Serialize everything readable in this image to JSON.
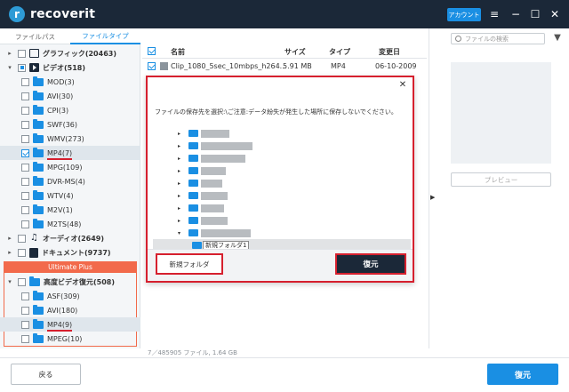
{
  "app": {
    "logo_text": "recoverit",
    "account_label": "アカウント"
  },
  "left_tabs": [
    "ファイルパス",
    "ファイルタイプ"
  ],
  "tree": [
    {
      "label": "グラフィック(20463)",
      "level": 0,
      "arrow": "▸",
      "check": "none",
      "icon": "graphics",
      "bold": true
    },
    {
      "label": "ビデオ(518)",
      "level": 0,
      "arrow": "▾",
      "check": "partial",
      "icon": "video",
      "bold": true
    },
    {
      "label": "MOD(3)",
      "level": 1,
      "check": "none",
      "icon": "folder"
    },
    {
      "label": "AVI(30)",
      "level": 1,
      "check": "none",
      "icon": "folder"
    },
    {
      "label": "CPI(3)",
      "level": 1,
      "check": "none",
      "icon": "folder"
    },
    {
      "label": "SWF(36)",
      "level": 1,
      "check": "none",
      "icon": "folder"
    },
    {
      "label": "WMV(273)",
      "level": 1,
      "check": "none",
      "icon": "folder"
    },
    {
      "label": "MP4(7)",
      "level": 1,
      "check": "checked",
      "icon": "folder",
      "selected": true,
      "underline": true
    },
    {
      "label": "MPG(109)",
      "level": 1,
      "check": "none",
      "icon": "folder"
    },
    {
      "label": "DVR-MS(4)",
      "level": 1,
      "check": "none",
      "icon": "folder"
    },
    {
      "label": "WTV(4)",
      "level": 1,
      "check": "none",
      "icon": "folder"
    },
    {
      "label": "M2V(1)",
      "level": 1,
      "check": "none",
      "icon": "folder"
    },
    {
      "label": "M2TS(48)",
      "level": 1,
      "check": "none",
      "icon": "folder"
    },
    {
      "label": "オーディオ(2649)",
      "level": 0,
      "arrow": "▸",
      "check": "none",
      "icon": "audio",
      "bold": true
    },
    {
      "label": "ドキュメント(9737)",
      "level": 0,
      "arrow": "▸",
      "check": "none",
      "icon": "document",
      "bold": true
    }
  ],
  "ultimate": {
    "label": "Ultimate Plus",
    "tree": [
      {
        "label": "高度ビデオ復元(508)",
        "level": 0,
        "arrow": "▾",
        "check": "none",
        "icon": "folder",
        "bold": true
      },
      {
        "label": "ASF(309)",
        "level": 1,
        "check": "none",
        "icon": "folder"
      },
      {
        "label": "AVI(180)",
        "level": 1,
        "check": "none",
        "icon": "folder"
      },
      {
        "label": "MP4(9)",
        "level": 1,
        "check": "none",
        "icon": "folder",
        "selected": true,
        "underline": true
      },
      {
        "label": "MPEG(10)",
        "level": 1,
        "check": "none",
        "icon": "folder"
      }
    ]
  },
  "file_list": {
    "headers": {
      "name": "名前",
      "size": "サイズ",
      "type": "タイプ",
      "modified": "変更日"
    },
    "rows": [
      {
        "name": "Clip_1080_5sec_10mbps_h264...",
        "size": "5.91 MB",
        "type": "MP4",
        "modified": "06-10-2009"
      }
    ],
    "status": "7／485905 ファイル, 1.64 GB"
  },
  "search_placeholder": "ファイルの検索",
  "preview_label": "プレビュー",
  "bottom": {
    "back_label": "戻る",
    "recover_label": "復元"
  },
  "dialog": {
    "message": "ファイルの保存先を選択:\\ご注意:データ紛失が発生した場所に保存しないでください。",
    "new_folder_name": "新規フォルダ1",
    "new_folder_button": "新規フォルダ",
    "ok_button": "復元"
  },
  "colors": {
    "titlebar": "#1b2838",
    "accent": "#1a8fe3",
    "highlight_red": "#d6202e",
    "ultimate": "#f26a4b"
  }
}
